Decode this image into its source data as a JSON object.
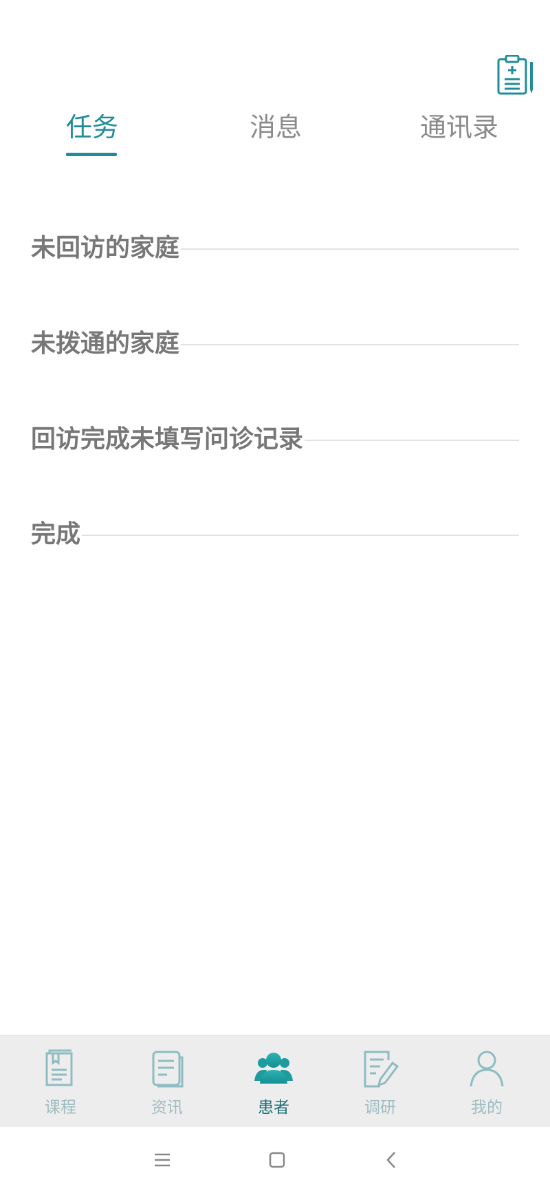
{
  "top_icon": "clipboard-medical-icon",
  "tabs": [
    {
      "label": "任务",
      "active": true
    },
    {
      "label": "消息",
      "active": false
    },
    {
      "label": "通讯录",
      "active": false
    }
  ],
  "sections": [
    {
      "title": "未回访的家庭"
    },
    {
      "title": "未拨通的家庭"
    },
    {
      "title": "回访完成未填写问诊记录"
    },
    {
      "title": "完成"
    }
  ],
  "bottom_nav": [
    {
      "label": "课程",
      "icon": "course-book-icon",
      "active": false
    },
    {
      "label": "资讯",
      "icon": "news-document-icon",
      "active": false
    },
    {
      "label": "患者",
      "icon": "patients-group-icon",
      "active": true
    },
    {
      "label": "调研",
      "icon": "survey-edit-icon",
      "active": false
    },
    {
      "label": "我的",
      "icon": "profile-person-icon",
      "active": false
    }
  ],
  "system_nav": [
    "menu-icon",
    "home-icon",
    "back-icon"
  ],
  "colors": {
    "accent": "#1f8c98",
    "tab_inactive": "#8a8a8a",
    "section_text": "#777777",
    "nav_inactive": "#9fbdc0",
    "nav_active": "#1f6f78",
    "bottom_bar_bg": "#ededed"
  }
}
